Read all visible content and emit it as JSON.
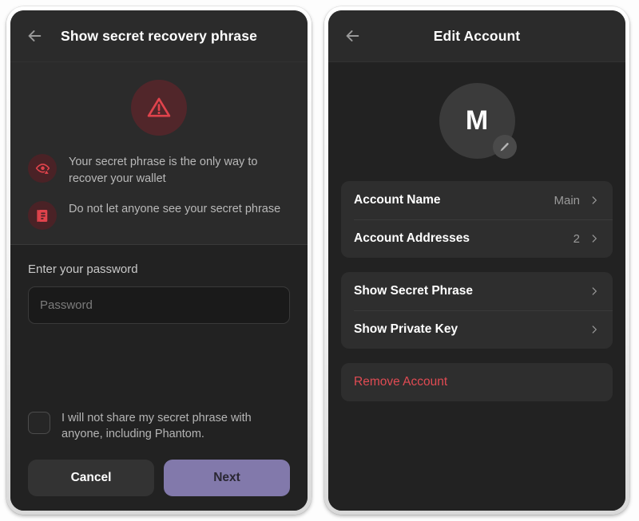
{
  "left_panel": {
    "header": {
      "title": "Show secret recovery phrase",
      "back_icon": "arrow-left-icon"
    },
    "warning_icon": "warning-triangle-icon",
    "warnings": [
      {
        "icon": "eye-warning-icon",
        "text": "Your secret phrase is the only way to recover your wallet"
      },
      {
        "icon": "document-lock-icon",
        "text": "Do not let anyone see your secret phrase"
      }
    ],
    "password": {
      "label": "Enter your password",
      "placeholder": "Password",
      "value": ""
    },
    "consent": {
      "checkbox_icon": "checkbox-unchecked-icon",
      "text": "I will not share my secret phrase with anyone, including Phantom.",
      "checked": false
    },
    "buttons": {
      "cancel": "Cancel",
      "next": "Next"
    }
  },
  "right_panel": {
    "header": {
      "title": "Edit Account",
      "back_icon": "arrow-left-icon"
    },
    "avatar": {
      "letter": "M",
      "edit_icon": "pencil-icon"
    },
    "group_one": [
      {
        "label": "Account Name",
        "value": "Main",
        "chevron": "chevron-right-icon"
      },
      {
        "label": "Account Addresses",
        "value": "2",
        "chevron": "chevron-right-icon"
      }
    ],
    "group_two": [
      {
        "label": "Show Secret Phrase",
        "value": "",
        "chevron": "chevron-right-icon"
      },
      {
        "label": "Show Private Key",
        "value": "",
        "chevron": "chevron-right-icon"
      }
    ],
    "group_three": [
      {
        "label": "Remove Account",
        "value": "",
        "chevron": ""
      }
    ]
  },
  "colors": {
    "accent_purple": "#8279ab",
    "danger_red": "#e04b53",
    "warning_bg": "#51262a",
    "screen_bg": "#222222",
    "header_bg": "#2b2b2b",
    "card_bg": "#2e2e2e"
  }
}
